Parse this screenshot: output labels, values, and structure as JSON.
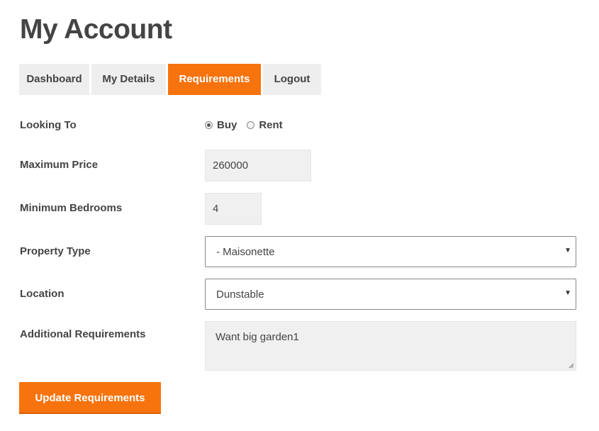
{
  "page": {
    "title": "My Account"
  },
  "tabs": [
    {
      "label": "Dashboard",
      "active": false
    },
    {
      "label": "My Details",
      "active": false
    },
    {
      "label": "Requirements",
      "active": true
    },
    {
      "label": "Logout",
      "active": false
    }
  ],
  "form": {
    "looking_to": {
      "label": "Looking To",
      "options": [
        {
          "label": "Buy",
          "checked": true
        },
        {
          "label": "Rent",
          "checked": false
        }
      ]
    },
    "max_price": {
      "label": "Maximum Price",
      "value": "260000"
    },
    "min_bedrooms": {
      "label": "Minimum Bedrooms",
      "value": "4"
    },
    "property_type": {
      "label": "Property Type",
      "selected": "- Maisonette"
    },
    "location": {
      "label": "Location",
      "selected": "Dunstable"
    },
    "additional": {
      "label": "Additional Requirements",
      "value": "Want big garden1"
    },
    "submit_label": "Update Requirements"
  },
  "colors": {
    "accent": "#f7730e",
    "tab_bg": "#eeeeee",
    "text": "#444444",
    "field_bg": "#f0f0f0"
  },
  "icons": {
    "select_arrow": "chevron-down-icon",
    "resize_grip": "resize-grip-icon"
  }
}
